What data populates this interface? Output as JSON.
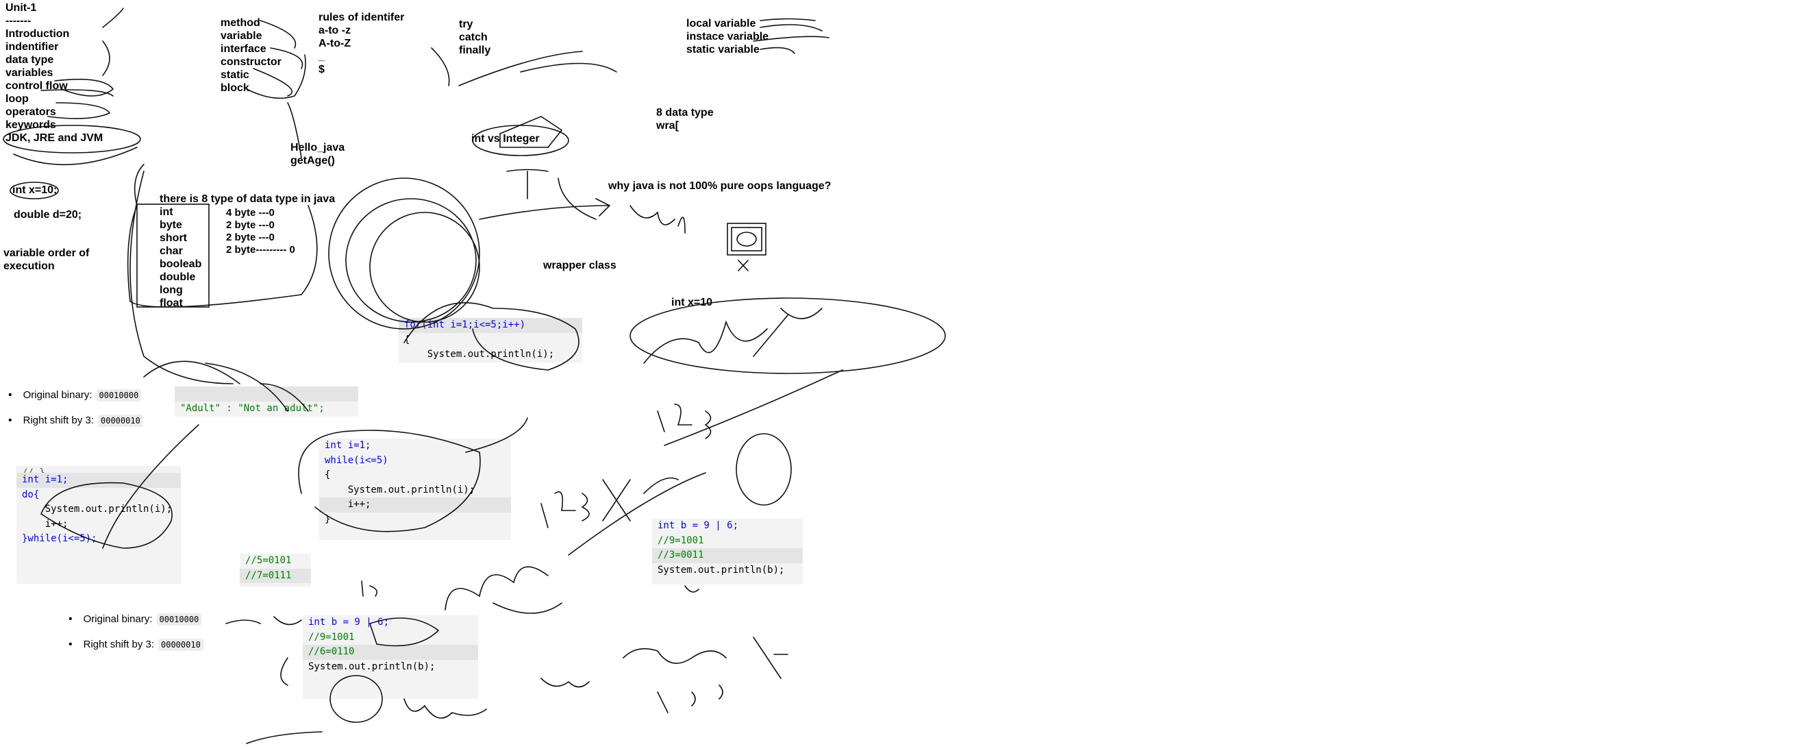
{
  "left_topics": [
    "Unit-1",
    "-------",
    "Introduction",
    "indentifier",
    "data type",
    "variables",
    "control flow",
    "loop",
    "operators",
    "keywords",
    "JDK, JRE and JVM"
  ],
  "examples": {
    "int_x": "int x=10;",
    "double_d": "double d=20;"
  },
  "variable_order": [
    "variable order of",
    "execution"
  ],
  "mid_topics": [
    "method",
    "variable",
    "interface",
    "constructor",
    "static",
    "block"
  ],
  "identifier_rules": [
    "rules of identifer",
    "a-to -z",
    "A-to-Z",
    "_",
    "$"
  ],
  "exceptions": [
    "try",
    "catch",
    "finally"
  ],
  "variable_types": [
    "local variable",
    "instace variable",
    "static variable"
  ],
  "hello": [
    "Hello_java",
    "getAge()"
  ],
  "int_vs_integer": "int vs Integer",
  "datatype_heading": "there is 8 type of data type in java",
  "datatypes": [
    "int",
    "byte",
    "short",
    "char",
    "booleab",
    "double",
    "long",
    "float"
  ],
  "sizes": [
    "4 byte   ---0",
    "2 byte   ---0",
    "2 byte ---0",
    "2 byte---------   0"
  ],
  "eight_wrapper": [
    "8 data type",
    "wra["
  ],
  "oops_question": "why java is not 100% pure oops language?",
  "wrapper_class": "wrapper class",
  "int_x10": "int x=10",
  "for_code": [
    "for(int i=1;i<=5;i++)",
    "{",
    "    System.out.println(i);"
  ],
  "ternary_code": "\"Adult\" : \"Not an adult\";",
  "bullets_top": [
    {
      "label": "Original binary:",
      "value": "00010000"
    },
    {
      "label": "Right shift by 3:",
      "value": "00000010"
    }
  ],
  "bullets_bottom": [
    {
      "label": "Original binary:",
      "value": "00010000"
    },
    {
      "label": "Right shift by 3:",
      "value": "00000010"
    }
  ],
  "do_code": [
    "// }",
    "int i=1;",
    "do{",
    "    System.out.println(i);",
    "    i++;",
    "}while(i<=5);"
  ],
  "while_code": [
    "int i=1;",
    "while(i<=5)",
    "{",
    "    System.out.println(i);",
    "    i++;",
    "}"
  ],
  "bin_comment": [
    "//5=0101",
    "//7=0111"
  ],
  "or_code_bottom": [
    "int b = 9 | 6;",
    "//9=1001",
    "//6=0110",
    "System.out.println(b);"
  ],
  "or_code_right": [
    "int b = 9 | 6;",
    "//9=1001",
    "//3=0011",
    "System.out.println(b);"
  ],
  "colors": {
    "keyword": "#0000ff",
    "comment": "#008000",
    "string": "#a31515",
    "code_bg": "#f3f3f3"
  }
}
